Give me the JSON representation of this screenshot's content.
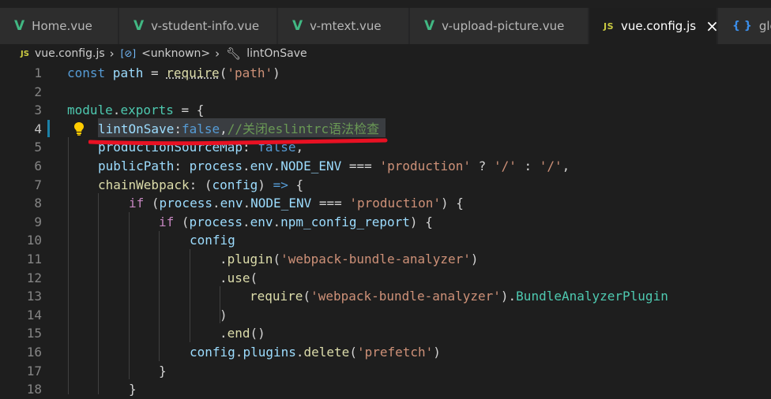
{
  "tabs": [
    {
      "label": "Home.vue",
      "icon": "vue-icon"
    },
    {
      "label": "v-student-info.vue",
      "icon": "vue-icon"
    },
    {
      "label": "v-mtext.vue",
      "icon": "vue-icon"
    },
    {
      "label": "v-upload-picture.vue",
      "icon": "vue-icon"
    },
    {
      "label": "vue.config.js",
      "icon": "js-icon",
      "active": true
    },
    {
      "label": "glob",
      "icon": "json-icon"
    }
  ],
  "icons": {
    "vue": "V",
    "js": "JS",
    "json": "{ }",
    "close": "×"
  },
  "breadcrumb": {
    "file": "vue.config.js",
    "symbol": "<unknown>",
    "function": "lintOnSave"
  },
  "line_numbers": [
    "1",
    "2",
    "3",
    "4",
    "5",
    "6",
    "7",
    "8",
    "9",
    "10",
    "11",
    "12",
    "13",
    "14",
    "15",
    "16",
    "17",
    "18"
  ],
  "code": {
    "l1": {
      "a": "const",
      "b": " path ",
      "c": "=",
      "d": " ",
      "e": "require",
      "f": "(",
      "g": "'path'",
      "h": ")"
    },
    "l3": {
      "a": "module",
      "b": ".",
      "c": "exports",
      "d": " = {"
    },
    "l4": {
      "a": "lintOnSave",
      "b": ":",
      "c": "false",
      "d": ",",
      "e": "//关闭eslintrc语法检查"
    },
    "l5": {
      "a": "productionSourceMap",
      "b": ": ",
      "c": "false",
      "d": ","
    },
    "l6": {
      "a": "publicPath",
      "b": ": ",
      "c": "process",
      "d": ".",
      "e": "env",
      "f": ".",
      "g": "NODE_ENV",
      "h": " === ",
      "i": "'production'",
      "j": " ? ",
      "k": "'/'",
      "l": " : ",
      "m": "'/'",
      "n": ","
    },
    "l7": {
      "a": "chainWebpack",
      "b": ": (",
      "c": "config",
      "d": ") ",
      "e": "=>",
      "f": " {"
    },
    "l8": {
      "a": "if",
      "b": " (",
      "c": "process",
      "d": ".",
      "e": "env",
      "f": ".",
      "g": "NODE_ENV",
      "h": " === ",
      "i": "'production'",
      "j": ") {"
    },
    "l9": {
      "a": "if",
      "b": " (",
      "c": "process",
      "d": ".",
      "e": "env",
      "f": ".",
      "g": "npm_config_report",
      "h": ") {"
    },
    "l10": {
      "a": "config"
    },
    "l11": {
      "a": ".",
      "b": "plugin",
      "c": "(",
      "d": "'webpack-bundle-analyzer'",
      "e": ")"
    },
    "l12": {
      "a": ".",
      "b": "use",
      "c": "("
    },
    "l13": {
      "a": "require",
      "b": "(",
      "c": "'webpack-bundle-analyzer'",
      "d": ").",
      "e": "BundleAnalyzerPlugin"
    },
    "l14": {
      "a": ")"
    },
    "l15": {
      "a": ".",
      "b": "end",
      "c": "()"
    },
    "l16": {
      "a": "config",
      "b": ".",
      "c": "plugins",
      "d": ".",
      "e": "delete",
      "f": "(",
      "g": "'prefetch'",
      "h": ")"
    },
    "l17": {
      "a": "}"
    },
    "l18": {
      "a": "}"
    }
  }
}
